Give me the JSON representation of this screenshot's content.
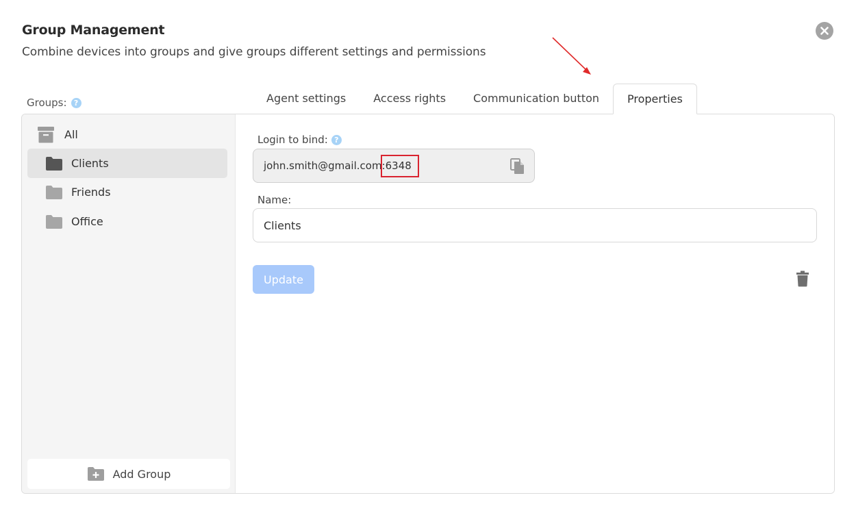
{
  "dialog": {
    "title": "Group Management",
    "subtitle": "Combine devices into groups and give groups different settings and permissions"
  },
  "groups": {
    "label": "Groups:",
    "help": "?",
    "items": [
      {
        "label": "All",
        "icon": "archive-icon",
        "selected": false
      },
      {
        "label": "Clients",
        "icon": "folder-icon",
        "selected": true
      },
      {
        "label": "Friends",
        "icon": "folder-icon",
        "selected": false
      },
      {
        "label": "Office",
        "icon": "folder-icon",
        "selected": false
      }
    ],
    "add_label": "Add Group"
  },
  "tabs": [
    {
      "label": "Agent settings",
      "active": false
    },
    {
      "label": "Access rights",
      "active": false
    },
    {
      "label": "Communication button",
      "active": false
    },
    {
      "label": "Properties",
      "active": true
    }
  ],
  "properties": {
    "login_label": "Login to bind:",
    "login_help": "?",
    "login_value": "john.smith@gmail.com:6348",
    "name_label": "Name:",
    "name_value": "Clients",
    "update_label": "Update"
  },
  "colors": {
    "accent_button": "#a8c9fb",
    "annotation": "#d9232f",
    "help_icon": "#a7d3f7"
  }
}
